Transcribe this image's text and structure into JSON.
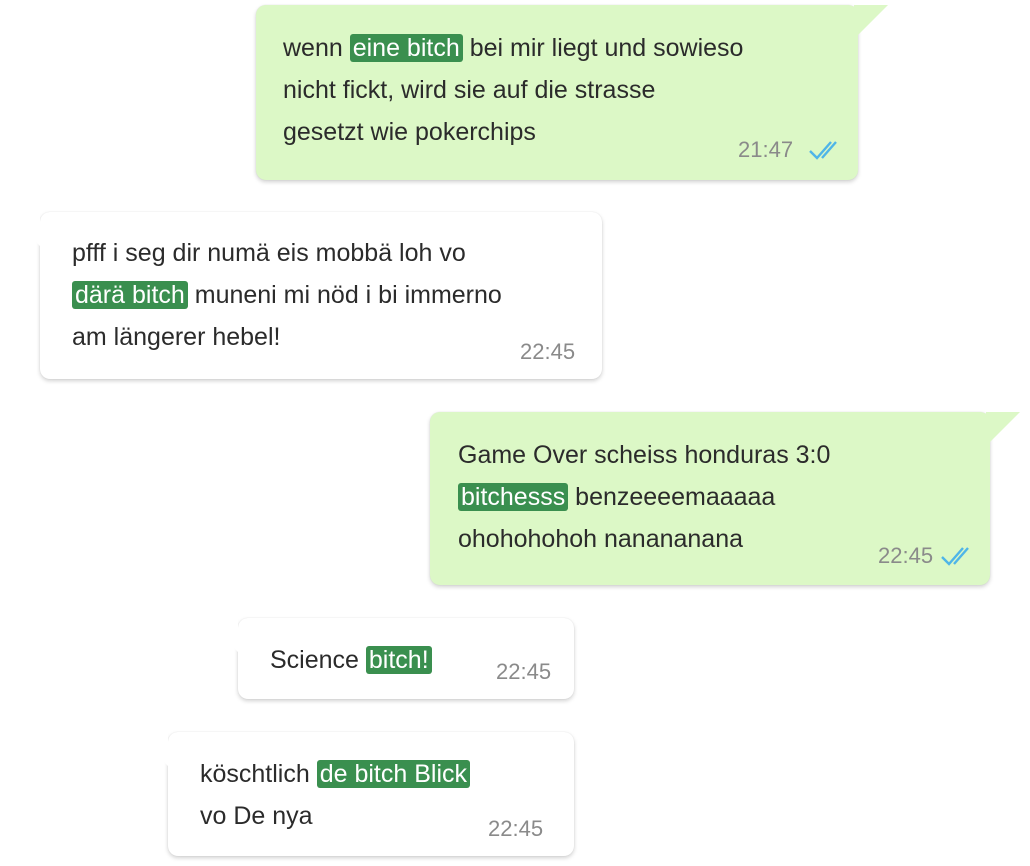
{
  "colors": {
    "outgoing_bubble": "#dcf8c6",
    "incoming_bubble": "#ffffff",
    "highlight": "#3a8f4f",
    "read_ticks": "#4fb5e8",
    "timestamp": "#8a8a8a"
  },
  "messages": [
    {
      "direction": "outgoing",
      "lines": [
        [
          "wenn ",
          {
            "hl": "eine bitch"
          },
          " bei mir liegt und sowieso"
        ],
        [
          "nicht fickt, wird sie auf die strasse"
        ],
        [
          "gesetzt wie pokerchips"
        ]
      ],
      "time": "21:47",
      "status_icon": "double-check-read-icon"
    },
    {
      "direction": "incoming",
      "lines": [
        [
          "pfff i seg dir numä eis mobbä loh vo"
        ],
        [
          {
            "hl": "därä bitch"
          },
          " muneni mi nöd i bi immerno"
        ],
        [
          "am längerer hebel!"
        ]
      ],
      "time": "22:45"
    },
    {
      "direction": "outgoing",
      "lines": [
        [
          "Game Over scheiss honduras 3:0"
        ],
        [
          {
            "hl": "bitchesss"
          },
          " benzeeeemaaaaa"
        ],
        [
          "ohohohohoh nanananana"
        ]
      ],
      "time": "22:45",
      "status_icon": "double-check-read-icon"
    },
    {
      "direction": "incoming",
      "lines": [
        [
          "Science ",
          {
            "hl": "bitch!"
          }
        ]
      ],
      "time": "22:45"
    },
    {
      "direction": "incoming",
      "lines": [
        [
          "köschtlich ",
          {
            "hl": "de bitch Blick"
          }
        ],
        [
          "vo De nya"
        ]
      ],
      "time": "22:45"
    }
  ]
}
